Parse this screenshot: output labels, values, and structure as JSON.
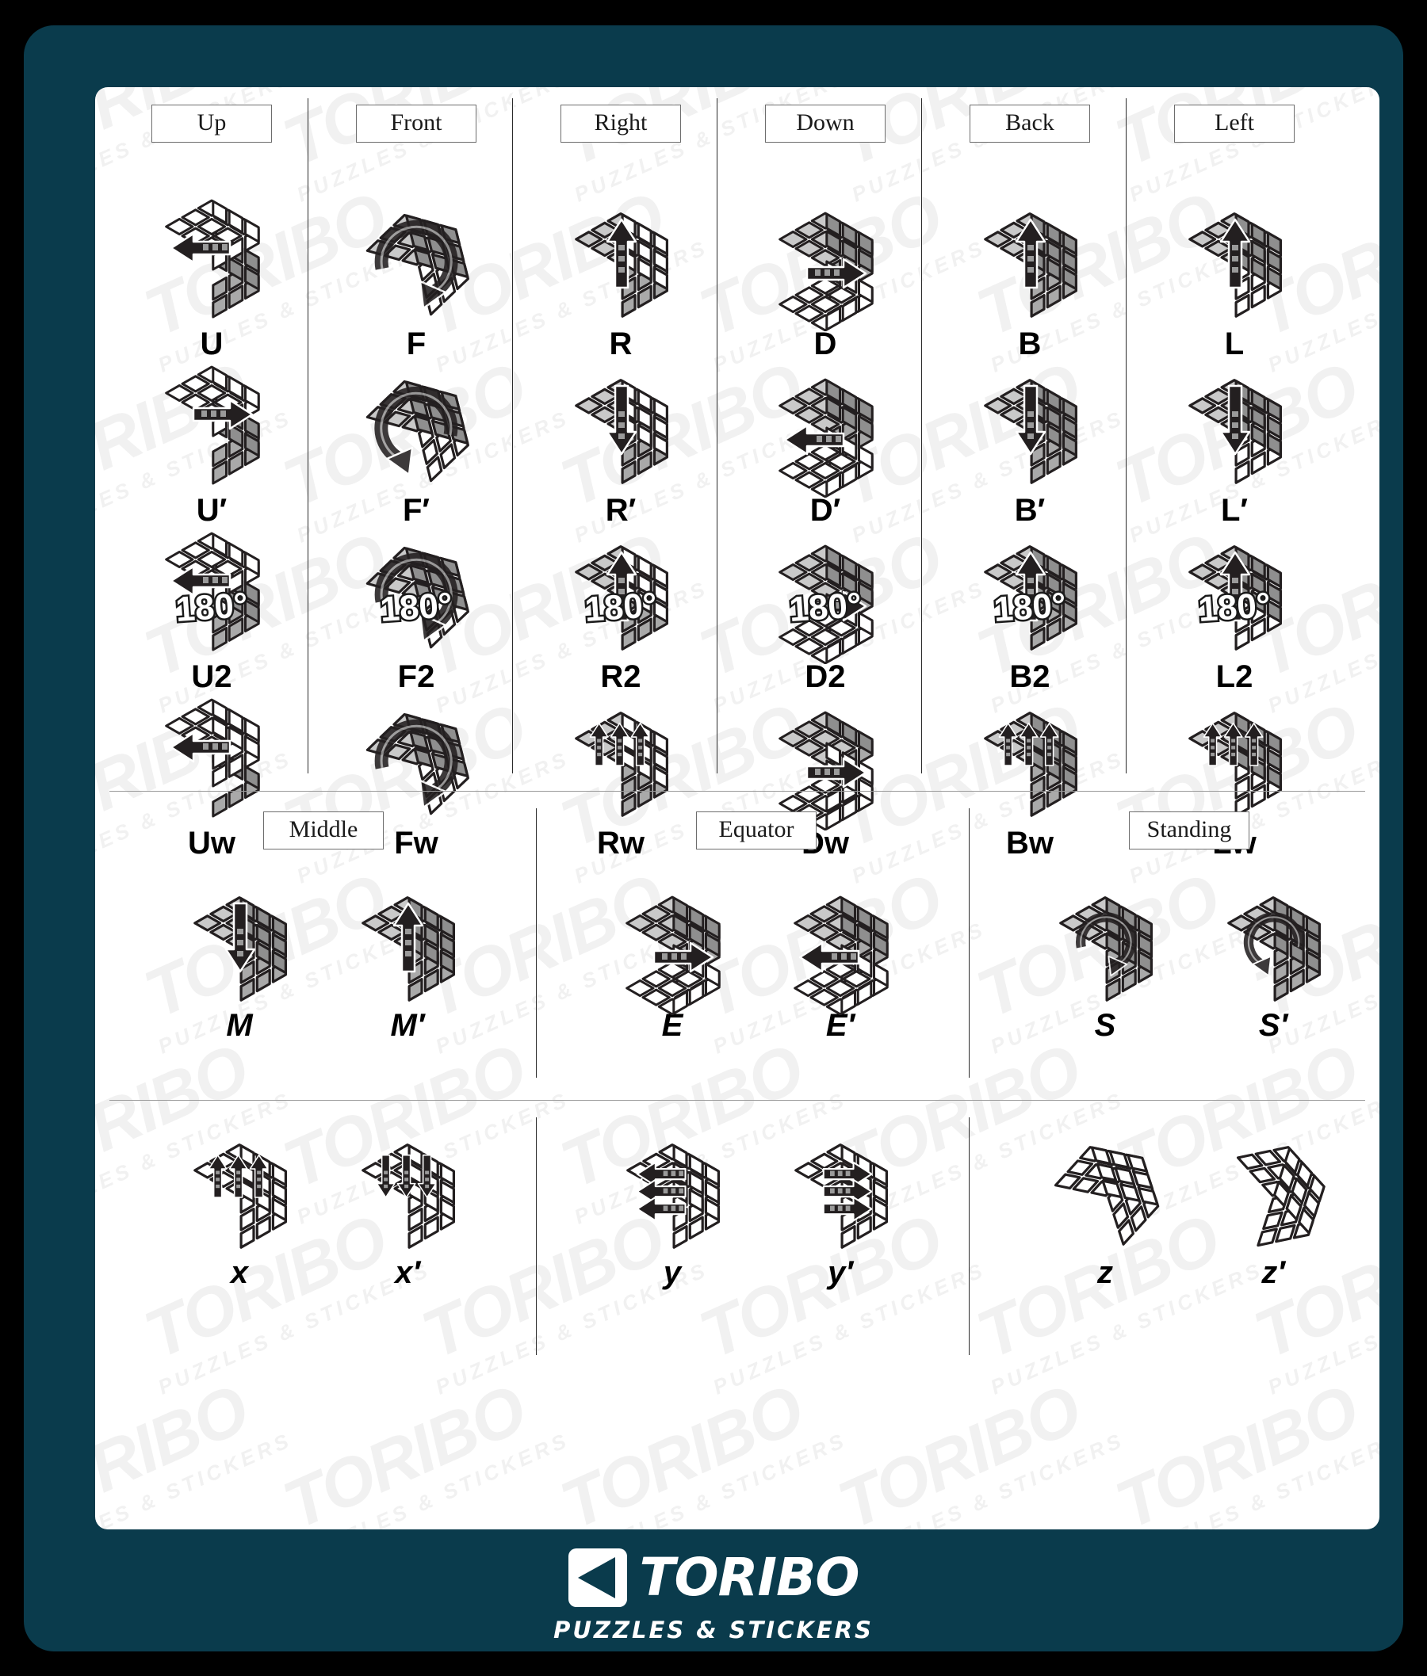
{
  "theme": {
    "outer_bg": "#000000",
    "card_bg": "#0a3b4c",
    "sheet_bg": "#ffffff",
    "rule_color": "#2b2b2b",
    "chip_border": "#6d6d6d",
    "label_color": "#000000",
    "watermark_color": "#f1f1f1"
  },
  "watermark": {
    "brand": "TORIBO",
    "tagline": "PUZZLES & STICKERS"
  },
  "face_section": {
    "columns": [
      {
        "header": "Up",
        "moves": [
          {
            "label": "U",
            "icon": "cube-u-turn",
            "degree": ""
          },
          {
            "label": "U′",
            "icon": "cube-u-prime-turn",
            "degree": ""
          },
          {
            "label": "U2",
            "icon": "cube-u-double-turn",
            "degree": "180°"
          },
          {
            "label": "Uw",
            "icon": "cube-u-wide-turn",
            "degree": ""
          }
        ]
      },
      {
        "header": "Front",
        "moves": [
          {
            "label": "F",
            "icon": "cube-f-turn",
            "degree": ""
          },
          {
            "label": "F′",
            "icon": "cube-f-prime-turn",
            "degree": ""
          },
          {
            "label": "F2",
            "icon": "cube-f-double-turn",
            "degree": "180°"
          },
          {
            "label": "Fw",
            "icon": "cube-f-wide-turn",
            "degree": ""
          }
        ]
      },
      {
        "header": "Right",
        "moves": [
          {
            "label": "R",
            "icon": "cube-r-turn",
            "degree": ""
          },
          {
            "label": "R′",
            "icon": "cube-r-prime-turn",
            "degree": ""
          },
          {
            "label": "R2",
            "icon": "cube-r-double-turn",
            "degree": "180°"
          },
          {
            "label": "Rw",
            "icon": "cube-r-wide-turn",
            "degree": ""
          }
        ]
      },
      {
        "header": "Down",
        "moves": [
          {
            "label": "D",
            "icon": "cube-d-turn",
            "degree": ""
          },
          {
            "label": "D′",
            "icon": "cube-d-prime-turn",
            "degree": ""
          },
          {
            "label": "D2",
            "icon": "cube-d-double-turn",
            "degree": "180°"
          },
          {
            "label": "Dw",
            "icon": "cube-d-wide-turn",
            "degree": ""
          }
        ]
      },
      {
        "header": "Back",
        "moves": [
          {
            "label": "B",
            "icon": "cube-b-turn",
            "degree": ""
          },
          {
            "label": "B′",
            "icon": "cube-b-prime-turn",
            "degree": ""
          },
          {
            "label": "B2",
            "icon": "cube-b-double-turn",
            "degree": "180°"
          },
          {
            "label": "Bw",
            "icon": "cube-b-wide-turn",
            "degree": ""
          }
        ]
      },
      {
        "header": "Left",
        "moves": [
          {
            "label": "L",
            "icon": "cube-l-turn",
            "degree": ""
          },
          {
            "label": "L′",
            "icon": "cube-l-prime-turn",
            "degree": ""
          },
          {
            "label": "L2",
            "icon": "cube-l-double-turn",
            "degree": "180°"
          },
          {
            "label": "Lw",
            "icon": "cube-l-wide-turn",
            "degree": ""
          }
        ]
      }
    ]
  },
  "slice_section": {
    "groups": [
      {
        "header": "Middle",
        "moves": [
          {
            "label": "M",
            "icon": "cube-m-slice"
          },
          {
            "label": "M′",
            "icon": "cube-m-prime-slice"
          }
        ]
      },
      {
        "header": "Equator",
        "moves": [
          {
            "label": "E",
            "icon": "cube-e-slice"
          },
          {
            "label": "E′",
            "icon": "cube-e-prime-slice"
          }
        ]
      },
      {
        "header": "Standing",
        "moves": [
          {
            "label": "S",
            "icon": "cube-s-slice"
          },
          {
            "label": "S′",
            "icon": "cube-s-prime-slice"
          }
        ]
      }
    ]
  },
  "rotation_section": {
    "groups": [
      {
        "header": "",
        "moves": [
          {
            "label": "x",
            "icon": "cube-x-rotation"
          },
          {
            "label": "x′",
            "icon": "cube-x-prime-rotation"
          }
        ]
      },
      {
        "header": "",
        "moves": [
          {
            "label": "y",
            "icon": "cube-y-rotation"
          },
          {
            "label": "y′",
            "icon": "cube-y-prime-rotation"
          }
        ]
      },
      {
        "header": "",
        "moves": [
          {
            "label": "z",
            "icon": "cube-z-rotation"
          },
          {
            "label": "z′",
            "icon": "cube-z-prime-rotation"
          }
        ]
      }
    ]
  },
  "footer": {
    "brand": "TORIBO",
    "tagline": "PUZZLES & STICKERS"
  }
}
